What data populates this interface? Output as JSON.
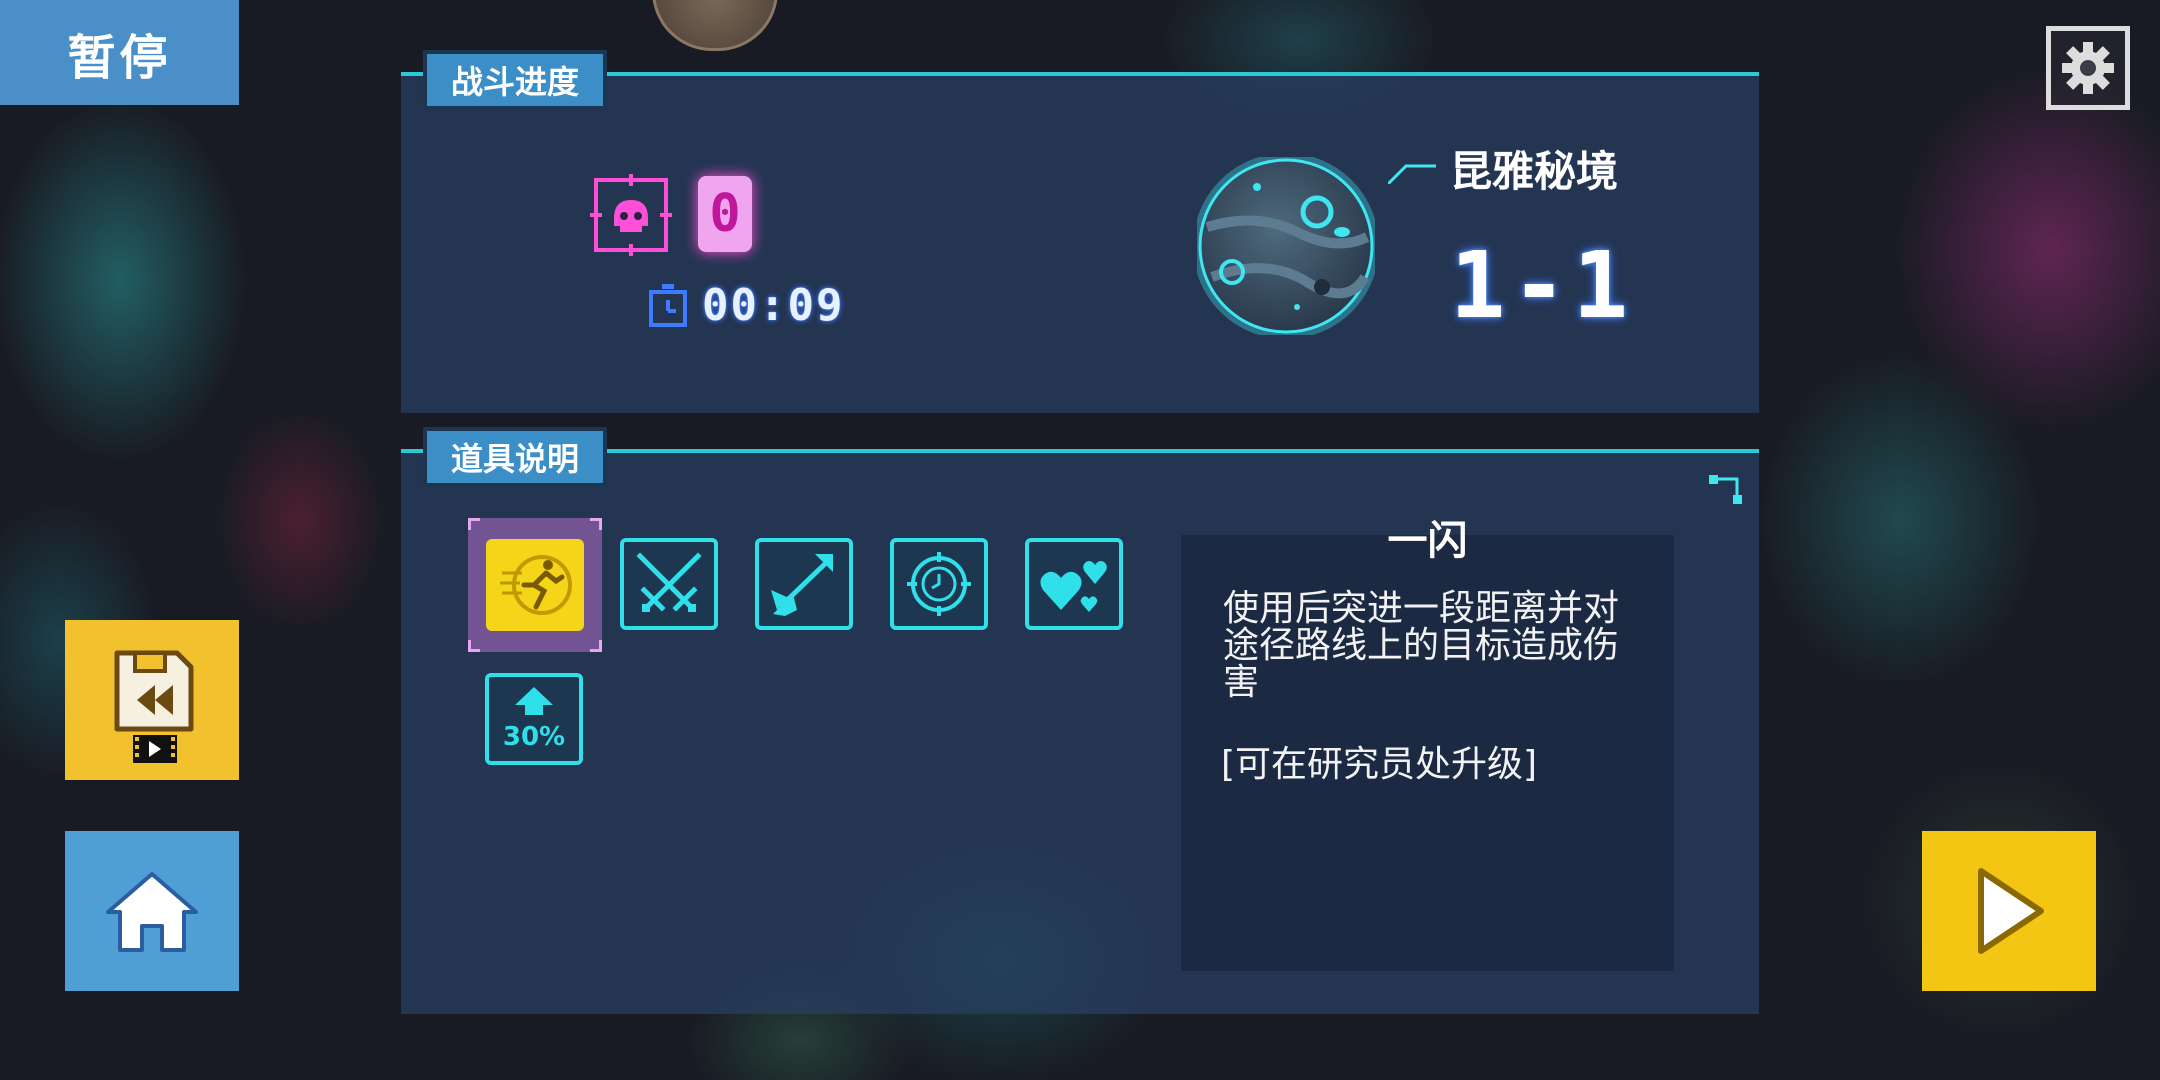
{
  "pause_label": "暂停",
  "battle_panel": {
    "title": "战斗进度",
    "kill_count": "0",
    "timer": "00:09",
    "stage_name": "昆雅秘境",
    "stage_number": "1-1"
  },
  "items_panel": {
    "title": "道具说明",
    "items": [
      {
        "icon": "dash-runner-icon",
        "selected": true
      },
      {
        "icon": "crossed-swords-icon",
        "selected": false
      },
      {
        "icon": "piercing-arrow-icon",
        "selected": false
      },
      {
        "icon": "target-clock-icon",
        "selected": false
      },
      {
        "icon": "hearts-icon",
        "selected": false
      },
      {
        "icon": "boost-30-icon",
        "label": "30%",
        "selected": false
      }
    ],
    "description": {
      "title": "一闪",
      "body": "使用后突进一段距离并对途径路线上的目标造成伤害",
      "note": "[可在研究员处升级]"
    }
  },
  "colors": {
    "accent_cyan": "#2fe0ea",
    "pause_blue": "#4a8fc8",
    "restore_yellow": "#f1c22e",
    "home_blue": "#4f9fd6",
    "kill_pink": "#f0a6ee"
  }
}
